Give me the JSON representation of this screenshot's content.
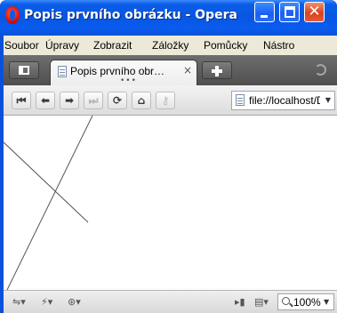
{
  "window": {
    "title": "Popis prvního obrázku - Opera"
  },
  "menu": {
    "items": [
      "Soubor",
      "Úpravy",
      "Zobrazit",
      "Záložky",
      "Pomůcky",
      "Nástro"
    ]
  },
  "tabs": {
    "active_title": "Popis prvního obr…",
    "close_glyph": "×",
    "dots": "•••"
  },
  "navigation": {
    "address": "file://localhost/D"
  },
  "status": {
    "zoom": "100%"
  },
  "colors": {
    "title_bar": "#0a51d9",
    "close_button": "#d9421c",
    "tab_bar": "#5a5a5a",
    "content_lines": "#555555"
  },
  "icons": [
    "opera-logo-icon",
    "minimize-icon",
    "maximize-icon",
    "close-icon",
    "panel-toggle-icon",
    "page-icon",
    "new-tab-icon",
    "trash-icon",
    "rewind-icon",
    "back-icon",
    "forward-icon",
    "fast-forward-icon",
    "reload-icon",
    "home-icon",
    "key-icon",
    "zoom-icon"
  ]
}
